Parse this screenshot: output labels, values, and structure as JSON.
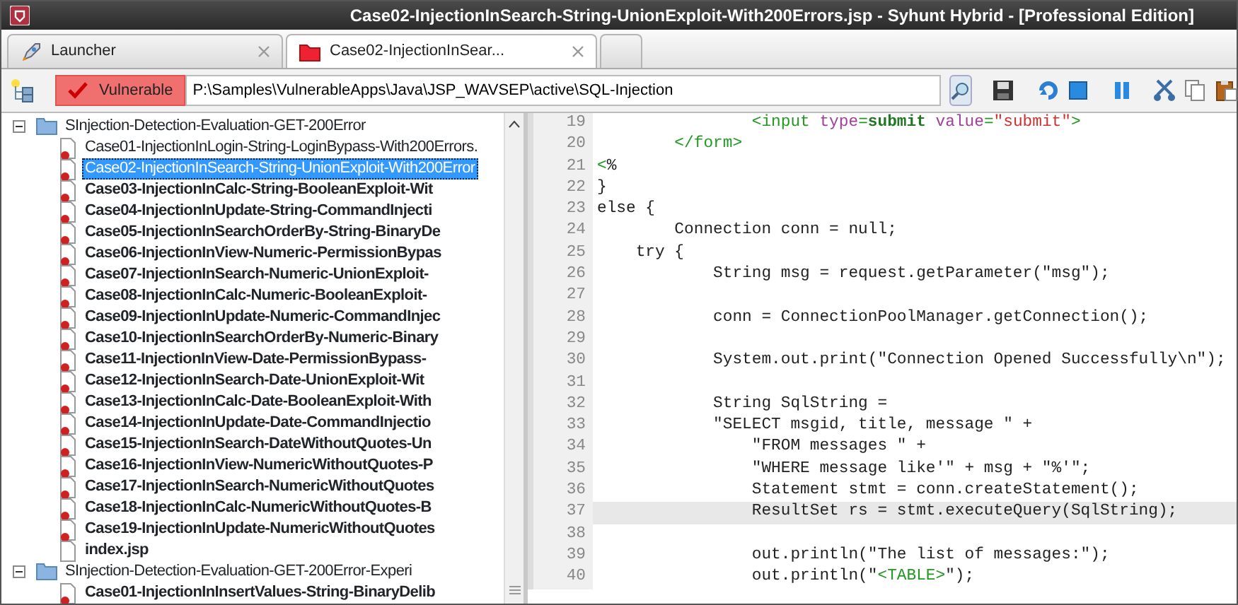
{
  "window": {
    "title": "Case02-InjectionInSearch-String-UnionExploit-With200Errors.jsp - Syhunt Hybrid - [Professional Edition]"
  },
  "tabs": [
    {
      "label": "Launcher",
      "kind": "launcher",
      "selected": false
    },
    {
      "label": "Case02-InjectionInSear...",
      "kind": "folder",
      "selected": true
    },
    {
      "kind": "empty",
      "selected": false
    }
  ],
  "toolbar": {
    "status": {
      "label": "Vulnerable",
      "kind": "vulnerable"
    },
    "path": "P:\\Samples\\VulnerableApps\\Java\\JSP_WAVSEP\\active\\SQL-Injection"
  },
  "tree": [
    {
      "label": "SInjection-Detection-Evaluation-GET-200Error",
      "expanded": true,
      "children": [
        {
          "label": "Case01-InjectionInLogin-String-LoginBypass-With200Errors.",
          "kind": "vulnerable",
          "bold": false,
          "selected": false
        },
        {
          "label": "Case02-InjectionInSearch-String-UnionExploit-With200Error",
          "kind": "vulnerable",
          "bold": false,
          "selected": true
        },
        {
          "label": "Case03-InjectionInCalc-String-BooleanExploit-Wit",
          "kind": "vulnerable",
          "bold": true,
          "selected": false
        },
        {
          "label": "Case04-InjectionInUpdate-String-CommandInjecti",
          "kind": "vulnerable",
          "bold": true,
          "selected": false
        },
        {
          "label": "Case05-InjectionInSearchOrderBy-String-BinaryDe",
          "kind": "vulnerable",
          "bold": true,
          "selected": false
        },
        {
          "label": "Case06-InjectionInView-Numeric-PermissionBypas",
          "kind": "vulnerable",
          "bold": true,
          "selected": false
        },
        {
          "label": "Case07-InjectionInSearch-Numeric-UnionExploit-",
          "kind": "vulnerable",
          "bold": true,
          "selected": false
        },
        {
          "label": "Case08-InjectionInCalc-Numeric-BooleanExploit-",
          "kind": "vulnerable",
          "bold": true,
          "selected": false
        },
        {
          "label": "Case09-InjectionInUpdate-Numeric-CommandInjec",
          "kind": "vulnerable",
          "bold": true,
          "selected": false
        },
        {
          "label": "Case10-InjectionInSearchOrderBy-Numeric-Binary",
          "kind": "vulnerable",
          "bold": true,
          "selected": false
        },
        {
          "label": "Case11-InjectionInView-Date-PermissionBypass-",
          "kind": "vulnerable",
          "bold": true,
          "selected": false
        },
        {
          "label": "Case12-InjectionInSearch-Date-UnionExploit-Wit",
          "kind": "vulnerable",
          "bold": true,
          "selected": false
        },
        {
          "label": "Case13-InjectionInCalc-Date-BooleanExploit-With",
          "kind": "vulnerable",
          "bold": true,
          "selected": false
        },
        {
          "label": "Case14-InjectionInUpdate-Date-CommandInjectio",
          "kind": "vulnerable",
          "bold": true,
          "selected": false
        },
        {
          "label": "Case15-InjectionInSearch-DateWithoutQuotes-Un",
          "kind": "vulnerable",
          "bold": true,
          "selected": false
        },
        {
          "label": "Case16-InjectionInView-NumericWithoutQuotes-P",
          "kind": "vulnerable",
          "bold": true,
          "selected": false
        },
        {
          "label": "Case17-InjectionInSearch-NumericWithoutQuotes",
          "kind": "vulnerable",
          "bold": true,
          "selected": false
        },
        {
          "label": "Case18-InjectionInCalc-NumericWithoutQuotes-B",
          "kind": "vulnerable",
          "bold": true,
          "selected": false
        },
        {
          "label": "Case19-InjectionInUpdate-NumericWithoutQuotes",
          "kind": "vulnerable",
          "bold": true,
          "selected": false
        },
        {
          "label": "index.jsp",
          "kind": "file",
          "bold": true,
          "selected": false
        }
      ]
    },
    {
      "label": "SInjection-Detection-Evaluation-GET-200Error-Experi",
      "expanded": true,
      "children": [
        {
          "label": "Case01-InjectionInInsertValues-String-BinaryDelib",
          "kind": "vulnerable",
          "bold": true,
          "selected": false
        }
      ]
    }
  ],
  "code": [
    {
      "number": "19",
      "highlighted": false,
      "segments": [
        {
          "kind": "tag",
          "text": "                <input "
        },
        {
          "kind": "attr",
          "text": "type"
        },
        {
          "kind": "tag",
          "text": "="
        },
        {
          "kind": "value",
          "text": "submit "
        },
        {
          "kind": "attr",
          "text": "value"
        },
        {
          "kind": "tag",
          "text": "="
        },
        {
          "kind": "string",
          "text": "\"submit\""
        },
        {
          "kind": "tag",
          "text": ">"
        }
      ]
    },
    {
      "number": "20",
      "highlighted": false,
      "segments": [
        {
          "kind": "tag",
          "text": "        </form>"
        }
      ]
    },
    {
      "number": "21",
      "highlighted": false,
      "segments": [
        {
          "kind": "tag",
          "text": "<"
        },
        {
          "kind": "plain",
          "text": "%"
        }
      ]
    },
    {
      "number": "22",
      "highlighted": false,
      "segments": [
        {
          "kind": "plain",
          "text": "}"
        }
      ]
    },
    {
      "number": "23",
      "highlighted": false,
      "segments": [
        {
          "kind": "plain",
          "text": "else {"
        }
      ]
    },
    {
      "number": "24",
      "highlighted": false,
      "segments": [
        {
          "kind": "plain",
          "text": "        Connection conn = null;"
        }
      ]
    },
    {
      "number": "25",
      "highlighted": false,
      "segments": [
        {
          "kind": "plain",
          "text": "    try {"
        }
      ]
    },
    {
      "number": "26",
      "highlighted": false,
      "segments": [
        {
          "kind": "plain",
          "text": "            String msg = request.getParameter(\"msg\");"
        }
      ]
    },
    {
      "number": "27",
      "highlighted": false
    },
    {
      "number": "28",
      "highlighted": false,
      "segments": [
        {
          "kind": "plain",
          "text": "            conn = ConnectionPoolManager.getConnection();"
        }
      ]
    },
    {
      "number": "29",
      "highlighted": false
    },
    {
      "number": "30",
      "highlighted": false,
      "segments": [
        {
          "kind": "plain",
          "text": "            System.out.print(\"Connection Opened Successfully\\n\");"
        }
      ]
    },
    {
      "number": "31",
      "highlighted": false
    },
    {
      "number": "32",
      "highlighted": false,
      "segments": [
        {
          "kind": "plain",
          "text": "            String SqlString ="
        }
      ]
    },
    {
      "number": "33",
      "highlighted": false,
      "segments": [
        {
          "kind": "plain",
          "text": "            \"SELECT msgid, title, message \" +"
        }
      ]
    },
    {
      "number": "34",
      "highlighted": false,
      "segments": [
        {
          "kind": "plain",
          "text": "                \"FROM messages \" +"
        }
      ]
    },
    {
      "number": "35",
      "highlighted": false,
      "segments": [
        {
          "kind": "plain",
          "text": "                \"WHERE message like'\" + msg + \"%'\";"
        }
      ]
    },
    {
      "number": "36",
      "highlighted": false,
      "segments": [
        {
          "kind": "plain",
          "text": "                Statement stmt = conn.createStatement();"
        }
      ]
    },
    {
      "number": "37",
      "highlighted": true,
      "segments": [
        {
          "kind": "plain",
          "text": "                ResultSet rs = stmt.executeQuery(SqlString);"
        }
      ]
    },
    {
      "number": "38",
      "highlighted": false
    },
    {
      "number": "39",
      "highlighted": false,
      "segments": [
        {
          "kind": "plain",
          "text": "                out.println(\"The list of messages:\");"
        }
      ]
    },
    {
      "number": "40",
      "highlighted": false,
      "segments": [
        {
          "kind": "plain",
          "text": "                out.println(\""
        },
        {
          "kind": "tag",
          "text": "<TABLE>"
        },
        {
          "kind": "plain",
          "text": "\");"
        }
      ]
    }
  ]
}
